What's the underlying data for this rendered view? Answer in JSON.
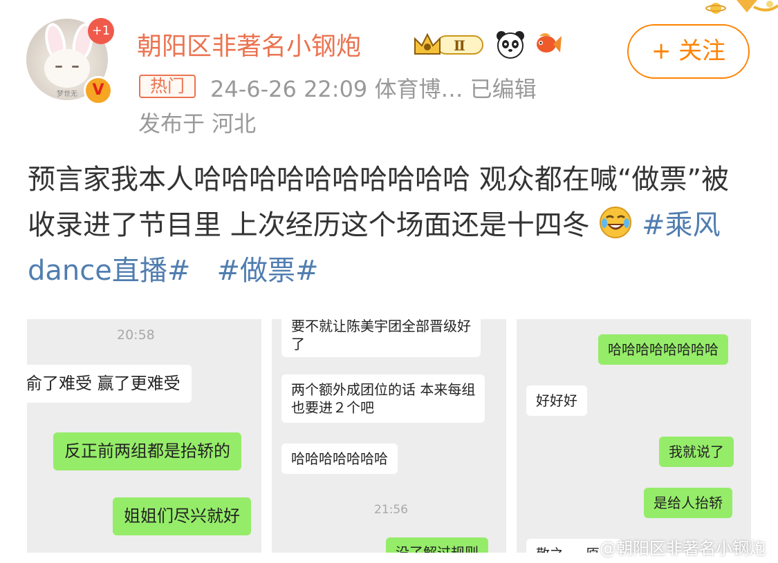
{
  "header": {
    "badge_count": "+1",
    "username": "朝阳区非著名小钢炮",
    "level_badge": "Ⅱ",
    "hot_tag": "热门",
    "meta": "24-6-26 22:09  体育博…  已编辑",
    "location": "发布于 河北",
    "follow_label": "+ 关注",
    "avatar_watermark": "梦世无"
  },
  "post": {
    "text": "预言家我本人哈哈哈哈哈哈哈哈哈哈 观众都在喊“做票”被收录进了节目里 上次经历这个场面还是十四冬",
    "hashtags": [
      "#乘风dance直播#",
      "#做票#"
    ]
  },
  "images": [
    {
      "time": "20:58",
      "messages": [
        "俞了难受 赢了更难受",
        "反正前两组都是抬轿的",
        "姐姐们尽兴就好"
      ]
    },
    {
      "time": "21:56",
      "messages": [
        "要不就让陈美宇团全部晋级好",
        "了",
        "两个额外成团位的话 本来每组",
        "也要进２个吧",
        "哈哈哈哈哈哈哈",
        "没了解过规则"
      ]
    },
    {
      "messages": [
        "哈哈哈哈哈哈哈哈",
        "好好好",
        "我就说了",
        "是给人抬轿",
        "敬之 ... 原..."
      ]
    }
  ],
  "watermark": "@朝阳区非著名小钢炮",
  "icons": [
    "crown-icon",
    "panda-icon",
    "koi-icon",
    "rofl-emoji-icon",
    "verified-icon"
  ],
  "colors": {
    "username": "#eb7350",
    "follow": "#ff8200",
    "hashtag": "#507daf",
    "bubble_green": "#95ec69"
  }
}
